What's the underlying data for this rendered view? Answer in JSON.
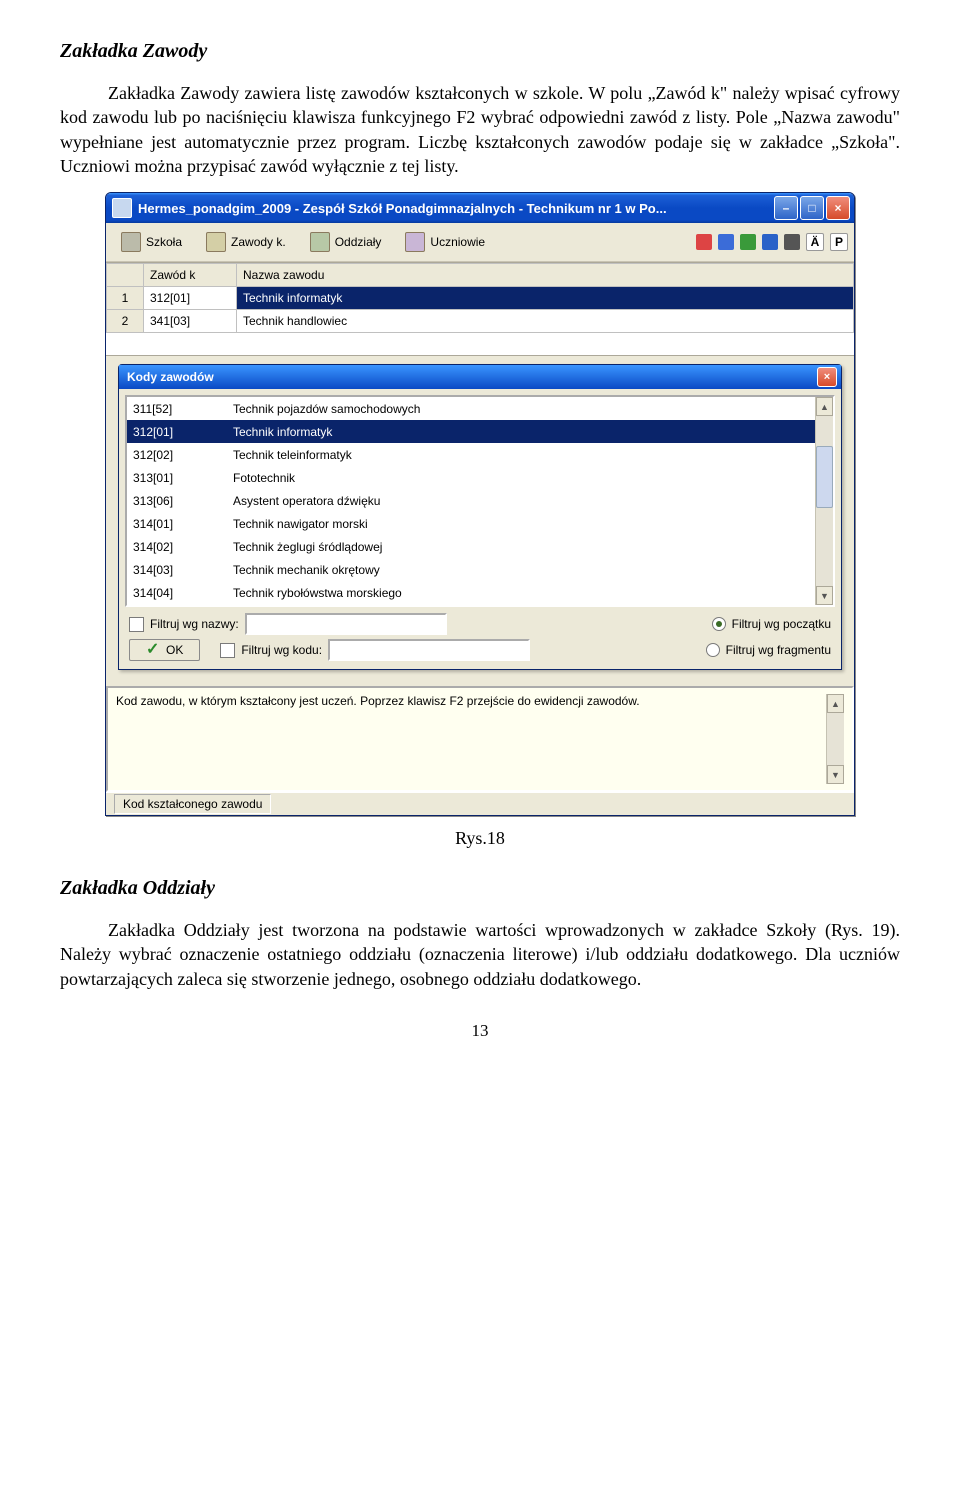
{
  "section1": {
    "heading": "Zakładka Zawody",
    "para": "Zakładka Zawody zawiera listę zawodów kształconych w szkole. W polu „Zawód k\" należy wpisać cyfrowy kod zawodu lub po naciśnięciu klawisza funkcyjnego F2 wybrać odpowiedni zawód z listy. Pole „Nazwa zawodu\" wypełniane jest automatycznie przez program. Liczbę kształconych zawodów podaje się w zakładce „Szkoła\". Uczniowi można przypisać zawód wyłącznie z tej listy."
  },
  "figure_caption": "Rys.18",
  "section2": {
    "heading": "Zakładka Oddziały",
    "para": "Zakładka Oddziały jest tworzona na podstawie wartości wprowadzonych w zakładce Szkoły (Rys. 19). Należy wybrać oznaczenie ostatniego oddziału (oznaczenia literowe) i/lub oddziału dodatkowego. Dla uczniów powtarzających zaleca się stworzenie jednego, osobnego oddziału dodatkowego."
  },
  "page_number": "13",
  "app": {
    "title": "Hermes_ponadgim_2009 - Zespół Szkół Ponadgimnazjalnych  -  Technikum nr 1 w Po...",
    "toolbar": {
      "szkola": "Szkoła",
      "zawody": "Zawody k.",
      "oddzialy": "Oddziały",
      "uczniowie": "Uczniowie",
      "letter_a": "Ä",
      "letter_p": "P"
    },
    "grid": {
      "col1": "Zawód k",
      "col2": "Nazwa zawodu",
      "rows": [
        {
          "n": "1",
          "code": "312[01]",
          "name": "Technik informatyk"
        },
        {
          "n": "2",
          "code": "341[03]",
          "name": "Technik handlowiec"
        }
      ]
    },
    "dialog": {
      "title": "Kody zawodów",
      "items": [
        {
          "code": "311[52]",
          "name": "Technik pojazdów samochodowych"
        },
        {
          "code": "312[01]",
          "name": "Technik informatyk"
        },
        {
          "code": "312[02]",
          "name": "Technik teleinformatyk"
        },
        {
          "code": "313[01]",
          "name": "Fototechnik"
        },
        {
          "code": "313[06]",
          "name": "Asystent operatora dźwięku"
        },
        {
          "code": "314[01]",
          "name": "Technik nawigator morski"
        },
        {
          "code": "314[02]",
          "name": "Technik żeglugi śródlądowej"
        },
        {
          "code": "314[03]",
          "name": "Technik mechanik okrętowy"
        },
        {
          "code": "314[04]",
          "name": "Technik rybołówstwa morskiego"
        }
      ],
      "selected_index": 1,
      "filter_name_label": "Filtruj wg nazwy:",
      "filter_code_label": "Filtruj wg kodu:",
      "filter_start_label": "Filtruj wg początku",
      "filter_fragment_label": "Filtruj wg fragmentu",
      "ok": "OK"
    },
    "hint": "Kod zawodu, w którym kształcony jest uczeń. Poprzez klawisz F2 przejście do ewidencji zawodów.",
    "status": "Kod kształconego zawodu"
  }
}
